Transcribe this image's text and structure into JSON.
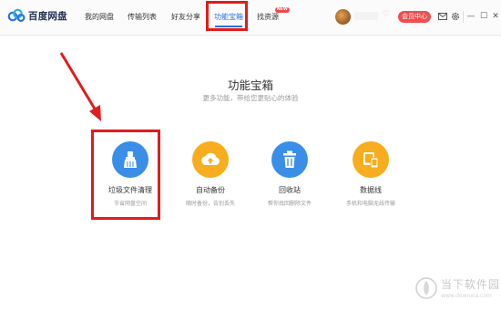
{
  "app": {
    "name": "百度网盘"
  },
  "nav": [
    {
      "label": "我的网盘"
    },
    {
      "label": "传输列表"
    },
    {
      "label": "好友分享"
    },
    {
      "label": "功能宝箱"
    },
    {
      "label": "找资源"
    }
  ],
  "nav_badge": "NEW",
  "user": {
    "vip_label": "会员中心"
  },
  "window_controls": {
    "minimize": "—",
    "maximize": "☐",
    "close": "✕"
  },
  "page": {
    "title": "功能宝箱",
    "subtitle": "更多功能，带给您更贴心的体验"
  },
  "features": [
    {
      "name": "垃圾文件清理",
      "desc": "节省网盘空间",
      "icon": "broom-icon",
      "color": "#3b8ee8"
    },
    {
      "name": "自动备份",
      "desc": "随时备份，告别丢失",
      "icon": "cloud-upload-icon",
      "color": "#f7ad1e"
    },
    {
      "name": "回收站",
      "desc": "帮你找回删除文件",
      "icon": "trash-icon",
      "color": "#3b8ee8"
    },
    {
      "name": "数据线",
      "desc": "手机和电脑无线传输",
      "icon": "devices-icon",
      "color": "#f7ad1e"
    }
  ],
  "watermark": {
    "title": "当下软件园",
    "url": "www.downxia.com"
  },
  "colors": {
    "accent": "#2b72e0",
    "annotation": "#e21c1c",
    "vip": "#ef4f4f"
  }
}
